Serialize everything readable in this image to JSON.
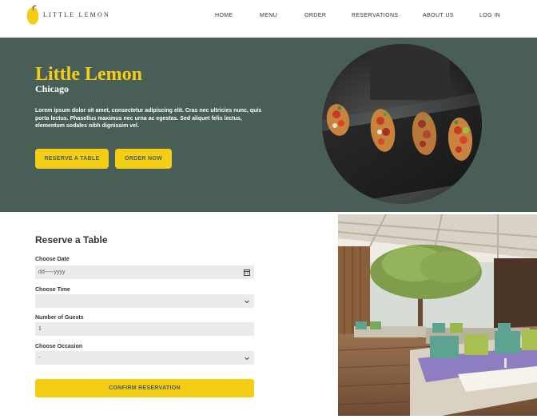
{
  "brand": {
    "name": "LITTLE LEMON"
  },
  "nav": {
    "items": [
      {
        "label": "HOME"
      },
      {
        "label": "MENU"
      },
      {
        "label": "ORDER"
      },
      {
        "label": "RESERVATIONS"
      },
      {
        "label": "ABOUT US"
      },
      {
        "label": "LOG IN"
      }
    ]
  },
  "hero": {
    "title": "Little Lemon",
    "subtitle": "Chicago",
    "description": "Lorem ipsum dolor sit amet, consectetur adipiscing elit. Cras nec ultricies nunc, quis porta lectus. Phasellus maximus nec urna ac egestas. Sed aliquet felis lectus, elementum sodales nibh dignissim vel.",
    "reserve_label": "RESERVE A TABLE",
    "order_label": "ORDER NOW"
  },
  "reservation": {
    "title": "Reserve a Table",
    "date_label": "Choose Date",
    "date_value": "dd-----yyyy",
    "time_label": "Choose Time",
    "time_value": "",
    "guests_label": "Number of Guests",
    "guests_value": "1",
    "occasion_label": "Choose Occasion",
    "occasion_value": "-",
    "confirm_label": "CONFIRM RESERVATION"
  },
  "colors": {
    "primary_green": "#495e57",
    "primary_yellow": "#f4ce14",
    "field_bg": "#e9ecea"
  },
  "icons": {
    "logo": "lemon-icon",
    "date": "calendar-icon",
    "select": "chevron-down-icon"
  }
}
